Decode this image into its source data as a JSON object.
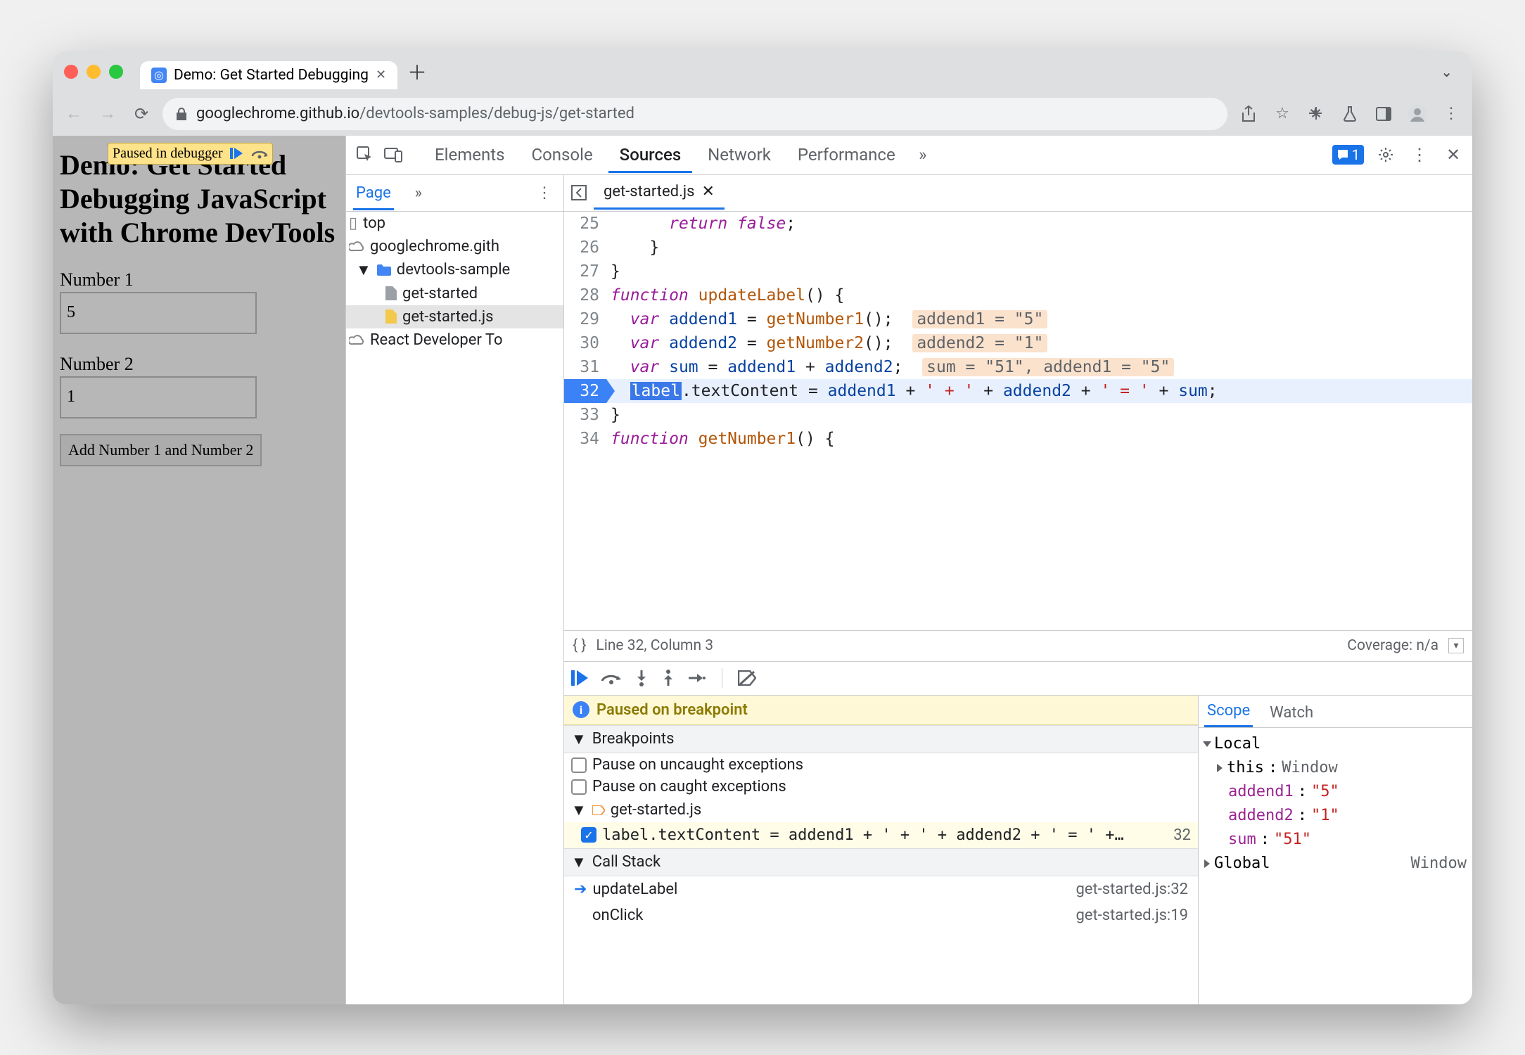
{
  "browser": {
    "tab_title": "Demo: Get Started Debugging",
    "url_host": "googlechrome.github.io",
    "url_path": "/devtools-samples/debug-js/get-started"
  },
  "page": {
    "paused_label": "Paused in debugger",
    "h1": "Demo: Get Started Debugging JavaScript with Chrome DevTools",
    "label1": "Number 1",
    "input1": "5",
    "label2": "Number 2",
    "input2": "1",
    "button": "Add Number 1 and Number 2"
  },
  "devtools": {
    "tabs": [
      "Elements",
      "Console",
      "Sources",
      "Network",
      "Performance"
    ],
    "issues_count": "1",
    "nav": {
      "page_tab": "Page",
      "tree": {
        "top": "top",
        "origin": "googlechrome.gith",
        "folder": "devtools-sample",
        "file_html": "get-started",
        "file_js": "get-started.js",
        "react": "React Developer To"
      }
    },
    "source": {
      "open_file": "get-started.js",
      "lines": [
        {
          "n": "25",
          "indent": 3,
          "tokens": [
            [
              "k",
              "return "
            ],
            [
              "k",
              "false"
            ],
            [
              "p",
              ";"
            ]
          ]
        },
        {
          "n": "26",
          "indent": 2,
          "tokens": [
            [
              "p",
              "}"
            ]
          ]
        },
        {
          "n": "27",
          "indent": 0,
          "tokens": [
            [
              "p",
              "}"
            ]
          ]
        },
        {
          "n": "28",
          "indent": 0,
          "tokens": [
            [
              "k",
              "function "
            ],
            [
              "f",
              "updateLabel"
            ],
            [
              "p",
              "() {"
            ]
          ]
        },
        {
          "n": "29",
          "indent": 1,
          "tokens": [
            [
              "k",
              "var "
            ],
            [
              "v",
              "addend1"
            ],
            [
              "p",
              " = "
            ],
            [
              "f",
              "getNumber1"
            ],
            [
              "p",
              "();"
            ]
          ],
          "hint": "addend1 = \"5\""
        },
        {
          "n": "30",
          "indent": 1,
          "tokens": [
            [
              "k",
              "var "
            ],
            [
              "v",
              "addend2"
            ],
            [
              "p",
              " = "
            ],
            [
              "f",
              "getNumber2"
            ],
            [
              "p",
              "();"
            ]
          ],
          "hint": "addend2 = \"1\""
        },
        {
          "n": "31",
          "indent": 1,
          "tokens": [
            [
              "k",
              "var "
            ],
            [
              "v",
              "sum"
            ],
            [
              "p",
              " = "
            ],
            [
              "v",
              "addend1"
            ],
            [
              "p",
              " + "
            ],
            [
              "v",
              "addend2"
            ],
            [
              "p",
              ";"
            ]
          ],
          "hint": "sum = \"51\", addend1 = \"5\""
        },
        {
          "n": "32",
          "indent": 1,
          "bp": true,
          "hl": true,
          "tokens": [
            [
              "sel",
              "label"
            ],
            [
              "p",
              ".textContent = "
            ],
            [
              "v",
              "addend1"
            ],
            [
              "p",
              " + "
            ],
            [
              "s",
              "' + '"
            ],
            [
              "p",
              " + "
            ],
            [
              "v",
              "addend2"
            ],
            [
              "p",
              " + "
            ],
            [
              "s",
              "' = '"
            ],
            [
              "p",
              " + "
            ],
            [
              "v",
              "sum"
            ],
            [
              "p",
              ";"
            ]
          ]
        },
        {
          "n": "33",
          "indent": 0,
          "tokens": [
            [
              "p",
              "}"
            ]
          ]
        },
        {
          "n": "34",
          "indent": 0,
          "tokens": [
            [
              "k",
              "function "
            ],
            [
              "f",
              "getNumber1"
            ],
            [
              "p",
              "() {"
            ]
          ]
        }
      ],
      "status_brackets": "{ }",
      "status_pos": "Line 32, Column 3",
      "coverage": "Coverage: n/a"
    },
    "debugger": {
      "paused_banner": "Paused on breakpoint",
      "breakpoints_label": "Breakpoints",
      "pause_uncaught": "Pause on uncaught exceptions",
      "pause_caught": "Pause on caught exceptions",
      "bp_file": "get-started.js",
      "bp_line_text": "label.textContent = addend1 + ' + ' + addend2 + ' = ' +…",
      "bp_line_no": "32",
      "callstack_label": "Call Stack",
      "stack": [
        {
          "fn": "updateLabel",
          "loc": "get-started.js:32",
          "current": true
        },
        {
          "fn": "onClick",
          "loc": "get-started.js:19",
          "current": false
        }
      ]
    },
    "scope": {
      "tabs": [
        "Scope",
        "Watch"
      ],
      "local_label": "Local",
      "this_label": "this",
      "this_value": "Window",
      "vars": [
        {
          "k": "addend1",
          "v": "\"5\""
        },
        {
          "k": "addend2",
          "v": "\"1\""
        },
        {
          "k": "sum",
          "v": "\"51\""
        }
      ],
      "global_label": "Global",
      "global_value": "Window"
    }
  }
}
